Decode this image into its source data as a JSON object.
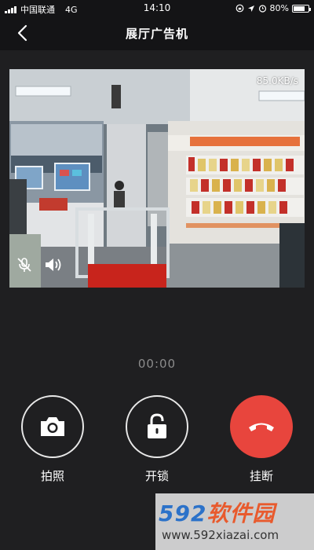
{
  "status_bar": {
    "carrier": "中国联通",
    "network": "4G",
    "time": "14:10",
    "battery": "80%",
    "battery_level": 0.8
  },
  "header": {
    "title": "展厅广告机"
  },
  "video": {
    "speed": "85.0KB/s",
    "scene_signs": [
      "企业荣誉",
      "DNAKE狄耐克"
    ]
  },
  "call": {
    "duration": "00:00"
  },
  "actions": {
    "photo_label": "拍照",
    "unlock_label": "开锁",
    "hangup_label": "挂断"
  },
  "watermark": {
    "logo_num": "592",
    "logo_cn": "软件园",
    "url": "www.592xiazai.com"
  },
  "colors": {
    "background": "#1f1f21",
    "hangup": "#e8453d",
    "timer": "#8c8c8c"
  }
}
